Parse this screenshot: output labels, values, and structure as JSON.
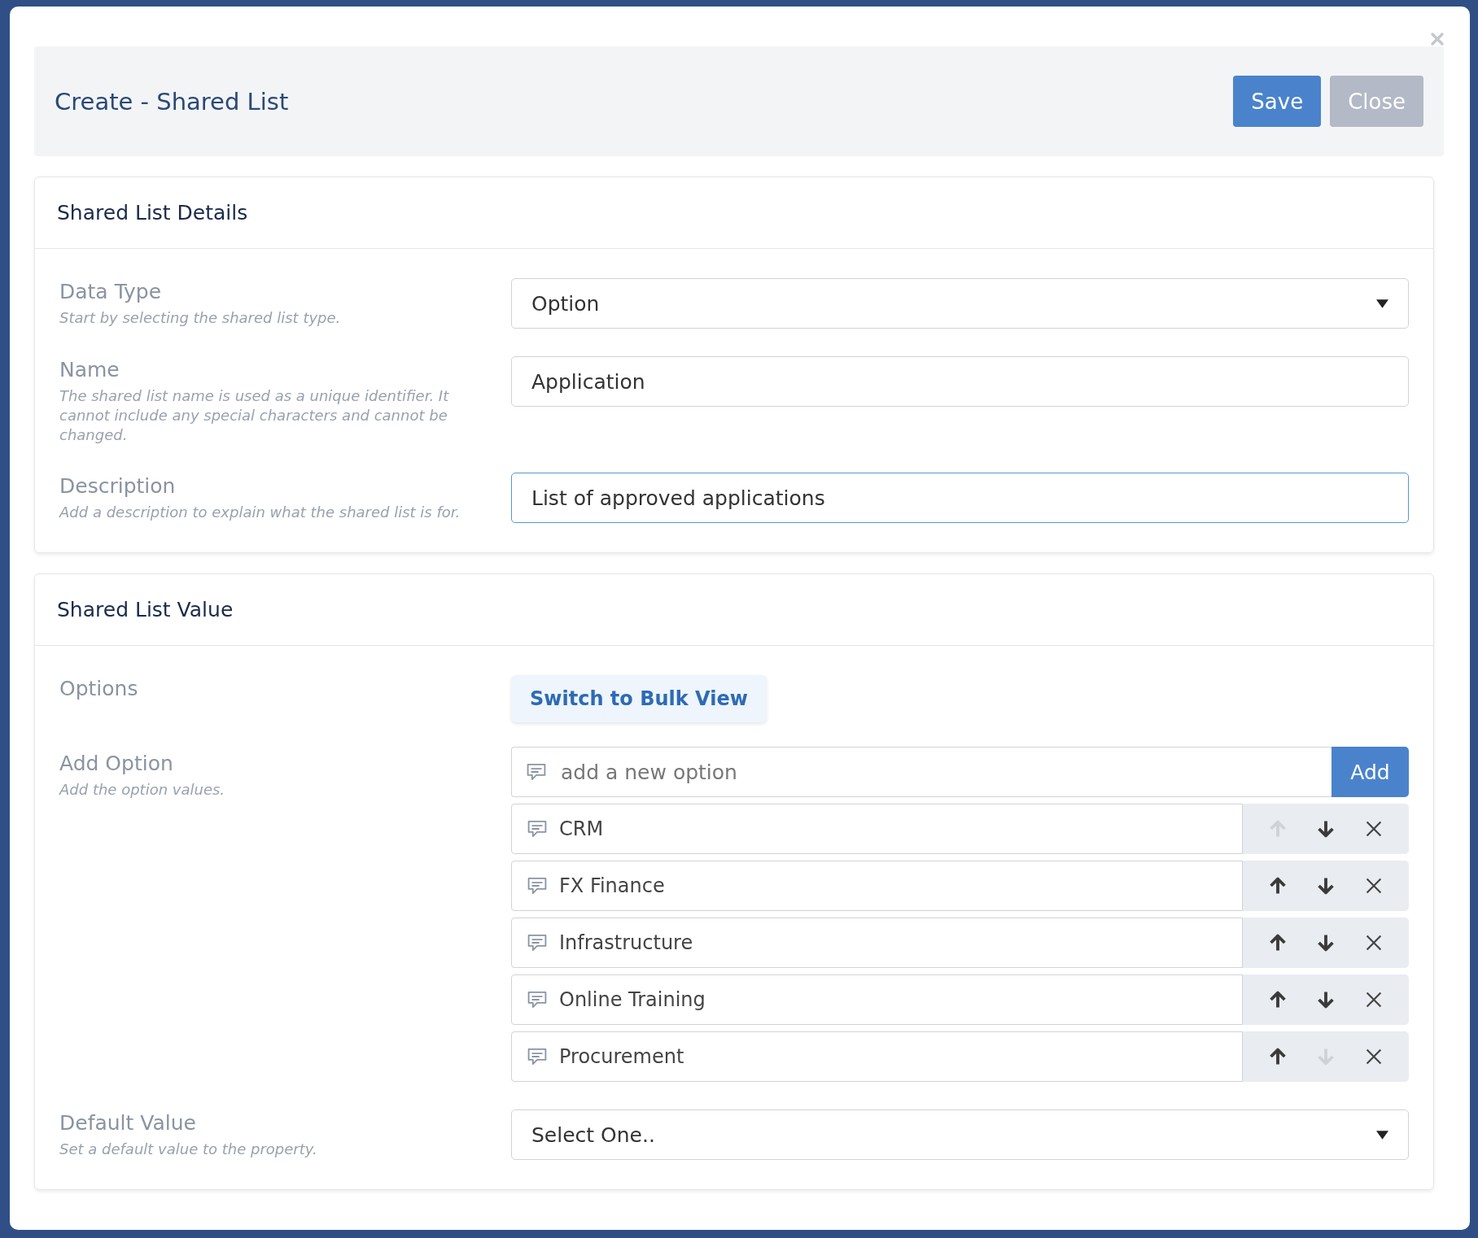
{
  "dialog": {
    "title": "Create - Shared List",
    "buttons": [
      {
        "label": "Save",
        "kind": "primary"
      },
      {
        "label": "Close",
        "kind": "secondary"
      }
    ]
  },
  "details": {
    "title": "Shared List Details",
    "fields": [
      {
        "kind": "select",
        "label": "Data Type",
        "hint": "Start by selecting the shared list type.",
        "value": "Option",
        "focused": false
      },
      {
        "kind": "text",
        "label": "Name",
        "hint": "The shared list name is used as a unique identifier. It cannot include any special characters and cannot be changed.",
        "value": "Application",
        "focused": false
      },
      {
        "kind": "text",
        "label": "Description",
        "hint": "Add a description to explain what the shared list is for.",
        "value": "List of approved applications",
        "focused": true
      }
    ]
  },
  "values": {
    "title": "Shared List Value",
    "options_label": "Options",
    "bulk_button": "Switch to Bulk View",
    "add_option": {
      "label": "Add Option",
      "hint": "Add the option values.",
      "placeholder": "add a new option",
      "button": "Add"
    },
    "options": [
      {
        "value": "CRM",
        "up_disabled": true,
        "down_disabled": false
      },
      {
        "value": "FX Finance",
        "up_disabled": false,
        "down_disabled": false
      },
      {
        "value": "Infrastructure",
        "up_disabled": false,
        "down_disabled": false
      },
      {
        "value": "Online Training",
        "up_disabled": false,
        "down_disabled": false
      },
      {
        "value": "Procurement",
        "up_disabled": false,
        "down_disabled": true
      }
    ],
    "default_value": {
      "label": "Default Value",
      "hint": "Set a default value to the property.",
      "value": "Select One.."
    }
  }
}
